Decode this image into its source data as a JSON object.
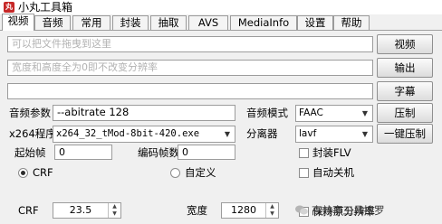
{
  "window": {
    "title": "小丸工具箱",
    "app_icon": "app-logo-icon"
  },
  "tabs": [
    {
      "label": "视频",
      "active": true
    },
    {
      "label": "音频",
      "active": false
    },
    {
      "label": "常用",
      "active": false
    },
    {
      "label": "封装",
      "active": false
    },
    {
      "label": "抽取",
      "active": false
    },
    {
      "label": "AVS",
      "active": false
    },
    {
      "label": "MediaInfo",
      "active": false
    },
    {
      "label": "设置",
      "active": false
    },
    {
      "label": "帮助",
      "active": false
    }
  ],
  "inputs": {
    "video_placeholder": "可以把文件拖曳到这里",
    "output_placeholder": "宽度和高度全为0即不改变分辨率",
    "subtitle_value": ""
  },
  "buttons": {
    "video": "视频",
    "output": "输出",
    "subtitle": "字幕",
    "compress": "压制",
    "one_click": "一键压制"
  },
  "audio": {
    "params_label": "音频参数",
    "params_value": "--abitrate 128",
    "mode_label": "音频模式",
    "mode_value": "FAAC"
  },
  "x264": {
    "program_label": "x264程序",
    "program_value": "x264_32_tMod-8bit-420.exe",
    "demuxer_label": "分离器",
    "demuxer_value": "lavf"
  },
  "frames": {
    "start_label": "起始帧",
    "start_value": "0",
    "encode_label": "编码帧数",
    "encode_value": "0"
  },
  "options": {
    "flv_label": "封装FLV",
    "flv_checked": false,
    "shutdown_label": "自动关机",
    "shutdown_checked": false,
    "keep_res_label": "保持原分辨率",
    "keep_res_checked": false
  },
  "rate_mode": {
    "crf_label": "CRF",
    "crf_selected": true,
    "custom_label": "自定义",
    "custom_selected": false
  },
  "crf": {
    "label": "CRF",
    "value": "23.5"
  },
  "width": {
    "label": "宽度",
    "value": "1280"
  },
  "watermark": {
    "text": "高效率工具搜罗"
  },
  "colors": {
    "accent_title_icon": "#c62828",
    "window_bg": "#f0f0f0"
  }
}
